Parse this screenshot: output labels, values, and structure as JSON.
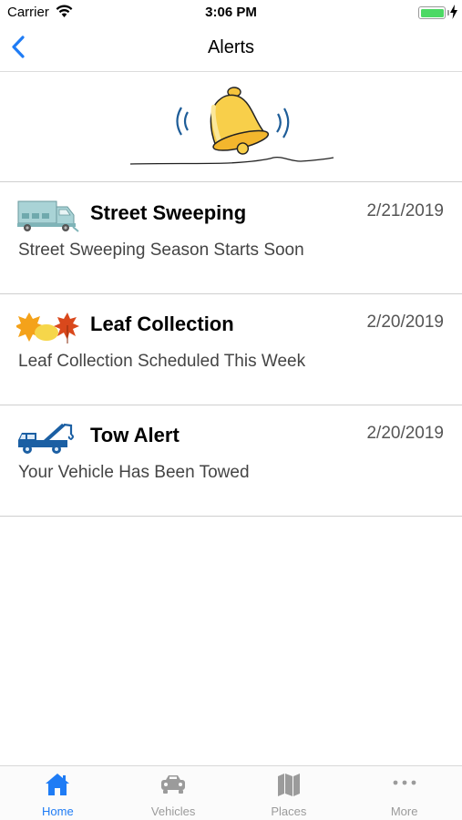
{
  "status_bar": {
    "carrier": "Carrier",
    "time": "3:06 PM"
  },
  "nav": {
    "title": "Alerts",
    "back_icon": "chevron-left-icon"
  },
  "banner": {
    "icon": "ringing-bell-icon"
  },
  "alerts": [
    {
      "icon": "street-sweeper-truck-icon",
      "title": "Street Sweeping",
      "date": "2/21/2019",
      "message": "Street Sweeping Season Starts Soon"
    },
    {
      "icon": "autumn-leaves-icon",
      "title": "Leaf Collection",
      "date": "2/20/2019",
      "message": "Leaf Collection Scheduled This Week"
    },
    {
      "icon": "tow-truck-icon",
      "title": "Tow Alert",
      "date": "2/20/2019",
      "message": "Your Vehicle Has Been Towed"
    }
  ],
  "tab_bar": {
    "active_tab": "Home",
    "tabs": [
      {
        "label": "Home",
        "icon": "home-icon"
      },
      {
        "label": "Vehicles",
        "icon": "car-icon"
      },
      {
        "label": "Places",
        "icon": "map-icon"
      },
      {
        "label": "More",
        "icon": "more-dots-icon"
      }
    ]
  },
  "colors": {
    "accent": "#1f7cf5",
    "battery": "#4cd964",
    "tab_inactive": "#9b9b9b",
    "truck_blue": "#1b5fa3"
  }
}
